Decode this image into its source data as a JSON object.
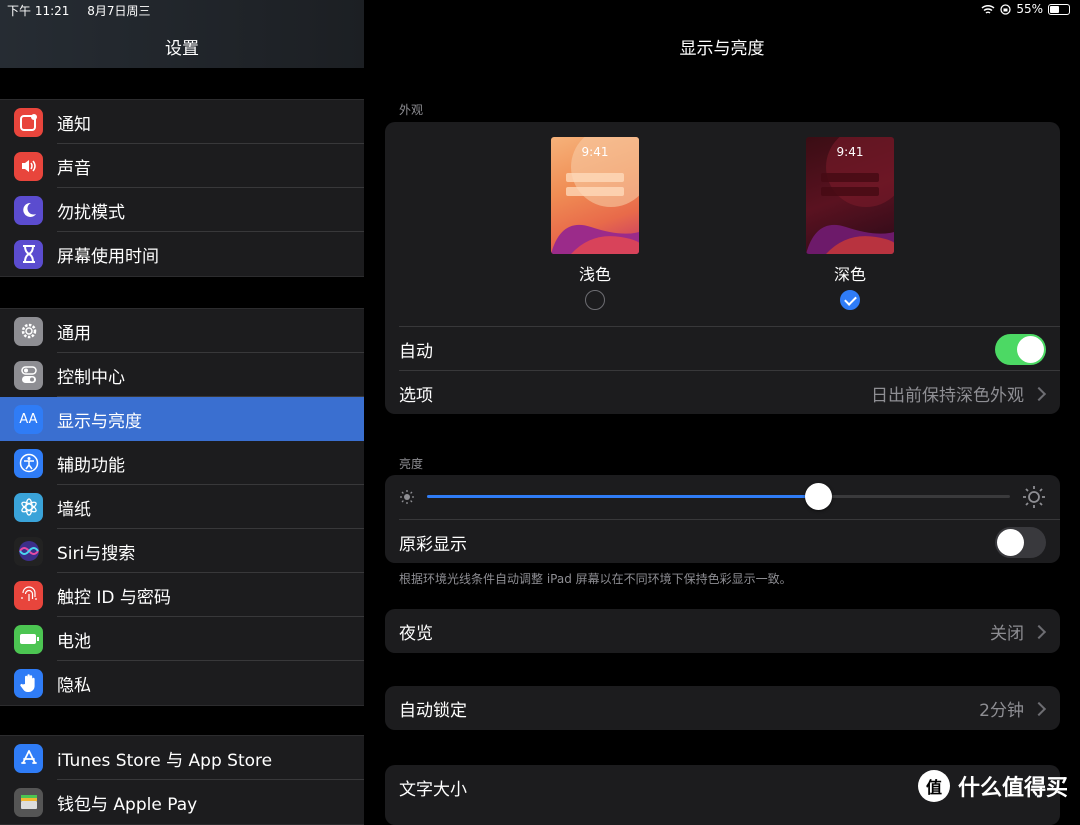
{
  "status_bar": {
    "time": "下午 11:21",
    "date": "8月7日周三",
    "battery_text": "55%",
    "battery_level": 0.55
  },
  "sidebar": {
    "title": "设置",
    "group1": [
      {
        "label": "通知",
        "icon": "notifications-icon",
        "color": "#e8453c"
      },
      {
        "label": "声音",
        "icon": "speaker-icon",
        "color": "#e8453c"
      },
      {
        "label": "勿扰模式",
        "icon": "moon-icon",
        "color": "#5b4ccf"
      },
      {
        "label": "屏幕使用时间",
        "icon": "hourglass-icon",
        "color": "#5b4ccf"
      }
    ],
    "group2": [
      {
        "label": "通用",
        "icon": "gear-icon",
        "color": "#8e8e93"
      },
      {
        "label": "控制中心",
        "icon": "toggles-icon",
        "color": "#8e8e93"
      },
      {
        "label": "显示与亮度",
        "icon": "display-aa-icon",
        "color": "#2f7cf6",
        "selected": true
      },
      {
        "label": "辅助功能",
        "icon": "accessibility-icon",
        "color": "#2f7cf6"
      },
      {
        "label": "墙纸",
        "icon": "flower-icon",
        "color": "#3aa3d9"
      },
      {
        "label": "Siri与搜索",
        "icon": "siri-icon",
        "color": "#222222"
      },
      {
        "label": "触控 ID 与密码",
        "icon": "fingerprint-icon",
        "color": "#e8453c"
      },
      {
        "label": "电池",
        "icon": "battery-icon",
        "color": "#4cc552"
      },
      {
        "label": "隐私",
        "icon": "hand-icon",
        "color": "#2f7cf6"
      }
    ],
    "group3": [
      {
        "label": "iTunes Store 与 App Store",
        "icon": "app-store-icon",
        "color": "#2f7cf6"
      },
      {
        "label": "钱包与 Apple Pay",
        "icon": "wallet-icon",
        "color": "#555555"
      }
    ]
  },
  "main": {
    "title": "显示与亮度",
    "appearance": {
      "section_label": "外观",
      "light": {
        "label": "浅色",
        "preview_time": "9:41",
        "selected": false
      },
      "dark": {
        "label": "深色",
        "preview_time": "9:41",
        "selected": true
      },
      "auto_label": "自动",
      "auto_on": true,
      "options_label": "选项",
      "options_value": "日出前保持深色外观"
    },
    "brightness": {
      "section_label": "亮度",
      "level": 0.67,
      "true_tone_label": "原彩显示",
      "true_tone_on": false,
      "footnote": "根据环境光线条件自动调整 iPad 屏幕以在不同环境下保持色彩显示一致。"
    },
    "night_shift": {
      "label": "夜览",
      "value": "关闭"
    },
    "auto_lock": {
      "label": "自动锁定",
      "value": "2分钟"
    },
    "text_size": {
      "label": "文字大小"
    }
  },
  "watermark": {
    "logo": "值",
    "text": "什么值得买"
  }
}
